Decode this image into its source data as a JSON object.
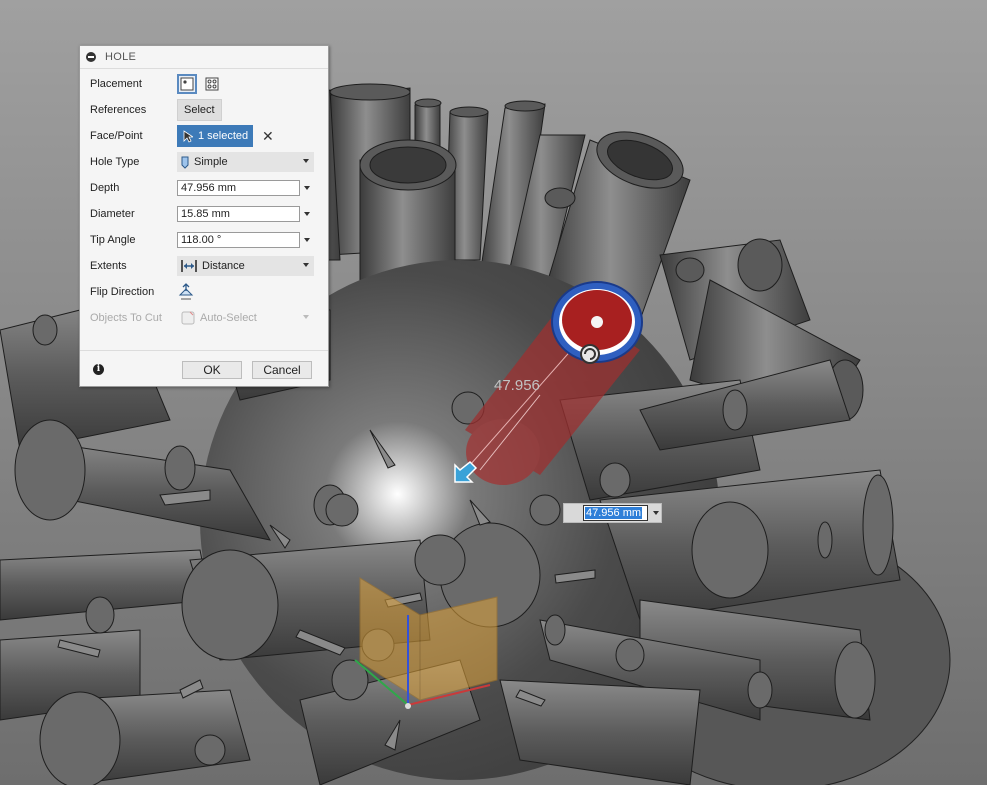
{
  "dialog": {
    "title": "HOLE",
    "rows": {
      "placement": {
        "label": "Placement"
      },
      "references": {
        "label": "References",
        "button": "Select"
      },
      "face_point": {
        "label": "Face/Point",
        "value": "1 selected"
      },
      "hole_type": {
        "label": "Hole Type",
        "value": "Simple"
      },
      "depth": {
        "label": "Depth",
        "value": "47.956 mm"
      },
      "diameter": {
        "label": "Diameter",
        "value": "15.85 mm"
      },
      "tip_angle": {
        "label": "Tip Angle",
        "value": "118.00 °"
      },
      "extents": {
        "label": "Extents",
        "value": "Distance"
      },
      "flip_direction": {
        "label": "Flip Direction"
      },
      "objects_to_cut": {
        "label": "Objects To Cut",
        "value": "Auto-Select"
      }
    },
    "ok": "OK",
    "cancel": "Cancel"
  },
  "viewport": {
    "dimension_label": "47.956",
    "depth_input": "47.956 mm"
  },
  "icons": [
    "collapse-icon",
    "single-hole-icon",
    "multi-hole-icon",
    "cursor-icon",
    "close-icon",
    "hole-icon",
    "extents-icon",
    "flip-icon",
    "auto-select-icon",
    "info-icon",
    "depth-arrow-icon"
  ],
  "colors": {
    "accent": "#3d7ab8",
    "hole_red": "#a82020",
    "ring_blue": "#2f5fc0",
    "origin_plane": "#e0a33a"
  }
}
